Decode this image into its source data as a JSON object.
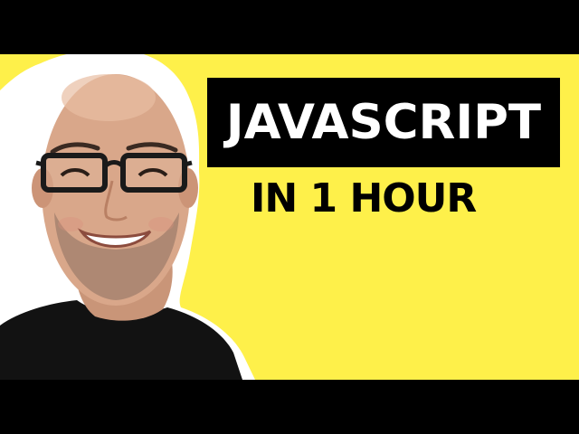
{
  "thumbnail": {
    "title": "JAVASCRIPT",
    "subtitle": "IN 1 HOUR",
    "colors": {
      "background": "#FEF04A",
      "letterbox": "#000000",
      "title_box": "#000000",
      "title_text": "#FFFFFF",
      "subtitle_text": "#000000",
      "outline": "#FFFFFF"
    }
  }
}
